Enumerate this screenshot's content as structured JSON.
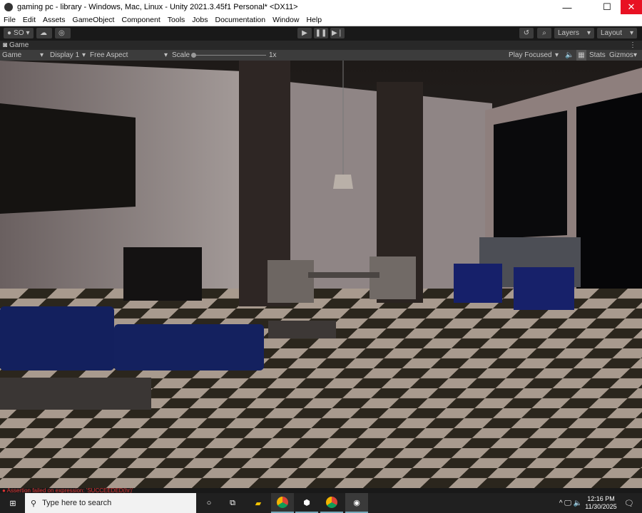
{
  "window": {
    "title": "gaming pc - library - Windows, Mac, Linux - Unity 2021.3.45f1 Personal* <DX11>",
    "minimize": "—",
    "maximize": "☐",
    "close": "✕"
  },
  "menu": [
    "File",
    "Edit",
    "Assets",
    "GameObject",
    "Component",
    "Tools",
    "Jobs",
    "Documentation",
    "Window",
    "Help"
  ],
  "toolbar": {
    "account": "SO",
    "layers": "Layers",
    "layout": "Layout"
  },
  "game_tab": {
    "label": "Game"
  },
  "game_bar": {
    "view": "Game",
    "display": "Display 1",
    "aspect": "Free Aspect",
    "scale_label": "Scale",
    "scale_value": "1x",
    "play_mode": "Play Focused",
    "stats": "Stats",
    "gizmos": "Gizmos"
  },
  "status": {
    "error": "Assertion failed on expression: 'SUCCEEDED(hr)'"
  },
  "taskbar": {
    "search_placeholder": "Type here to search",
    "time": "12:16 PM",
    "date": "11/30/2025"
  }
}
